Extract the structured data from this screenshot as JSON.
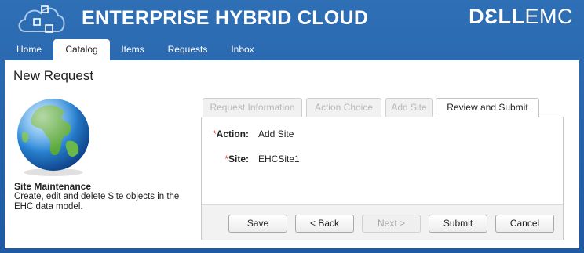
{
  "header": {
    "title": "ENTERPRISE HYBRID CLOUD",
    "vendor_logo_bold": "DƐLL",
    "vendor_logo_light": "EMC"
  },
  "nav": {
    "tabs": [
      {
        "label": "Home",
        "active": false
      },
      {
        "label": "Catalog",
        "active": true
      },
      {
        "label": "Items",
        "active": false
      },
      {
        "label": "Requests",
        "active": false
      },
      {
        "label": "Inbox",
        "active": false
      }
    ]
  },
  "page": {
    "title": "New Request"
  },
  "catalog_item": {
    "icon": "globe-icon",
    "name": "Site Maintenance",
    "description": "Create, edit and delete Site objects in the EHC data model."
  },
  "wizard": {
    "tabs": [
      {
        "label": "Request Information",
        "active": false
      },
      {
        "label": "Action Choice",
        "active": false
      },
      {
        "label": "Add Site",
        "active": false
      },
      {
        "label": "Review and Submit",
        "active": true
      }
    ],
    "fields": [
      {
        "label": "Action:",
        "value": "Add Site",
        "required": true
      },
      {
        "label": "Site:",
        "value": "EHCSite1",
        "required": true
      }
    ],
    "required_marker": "*",
    "buttons": {
      "save": "Save",
      "back": "< Back",
      "next": "Next >",
      "submit": "Submit",
      "cancel": "Cancel"
    }
  },
  "colors": {
    "header_bg": "#2f6fb5",
    "required_star": "#c0392b"
  }
}
